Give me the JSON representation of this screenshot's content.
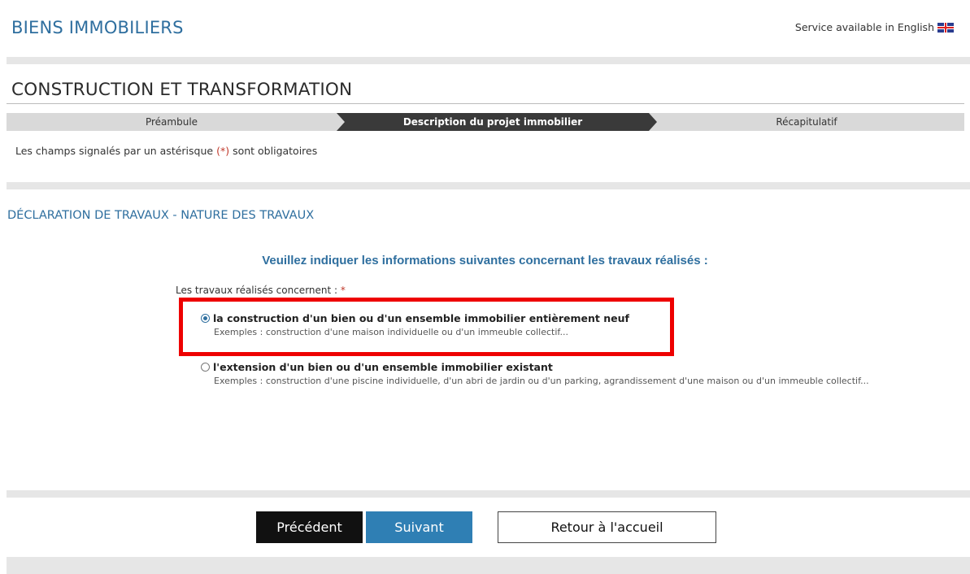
{
  "header": {
    "brand": "BIENS IMMOBILIERS",
    "language_link": "Service available in English",
    "language_flag_icon": "uk-flag-icon"
  },
  "page": {
    "title": "CONSTRUCTION ET TRANSFORMATION",
    "steps": [
      {
        "label": "Préambule",
        "state": "done"
      },
      {
        "label": "Description du projet immobilier",
        "state": "active"
      },
      {
        "label": "Récapitulatif",
        "state": "pending"
      }
    ],
    "required_note_prefix": "Les champs signalés par un astérisque",
    "required_note_symbol": "(*)",
    "required_note_suffix": "sont obligatoires"
  },
  "section": {
    "title": "DÉCLARATION DE TRAVAUX - NATURE DES TRAVAUX",
    "question": "Veuillez indiquer les informations suivantes concernant les travaux réalisés :",
    "field_label": "Les travaux réalisés concernent :",
    "field_required": "*",
    "options": [
      {
        "label": "la construction d'un bien ou d'un ensemble immobilier entièrement neuf",
        "example": "Exemples : construction d'une maison individuelle ou d'un immeuble collectif...",
        "selected": true
      },
      {
        "label": "l'extension d'un bien ou d'un ensemble immobilier existant",
        "example": "Exemples : construction d'une piscine individuelle, d'un abri de jardin ou d'un parking, agrandissement d'une maison ou d'un immeuble collectif...",
        "selected": false
      }
    ]
  },
  "buttons": {
    "previous": "Précédent",
    "next": "Suivant",
    "home": "Retour à l'accueil"
  },
  "colors": {
    "accent": "#2f6f9f",
    "primary_button": "#2f7fb4",
    "highlight": "#ee0000"
  }
}
